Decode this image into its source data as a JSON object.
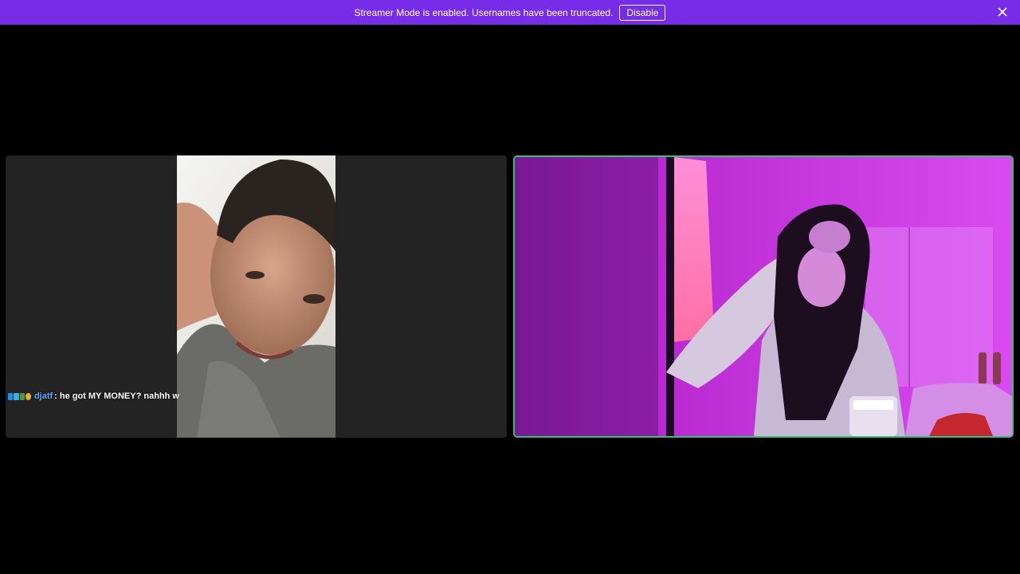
{
  "banner": {
    "message": "Streamer Mode is enabled. Usernames have been truncated.",
    "disable_label": "Disable",
    "close_icon": "close-icon",
    "color": "#772ce8"
  },
  "chat_overlay": {
    "badges": [
      "prime-badge-icon",
      "cube-badge-icon",
      "gift-badge-icon",
      "coin-badge-icon"
    ],
    "username": "djatf",
    "separator": ":",
    "message": "he got MY MONEY? nahhh w"
  },
  "tiles": {
    "left": {
      "kind": "camera-feed",
      "background": "#232323"
    },
    "right": {
      "kind": "camera-feed",
      "active_speaker": true,
      "border_color": "#34c07a"
    }
  }
}
